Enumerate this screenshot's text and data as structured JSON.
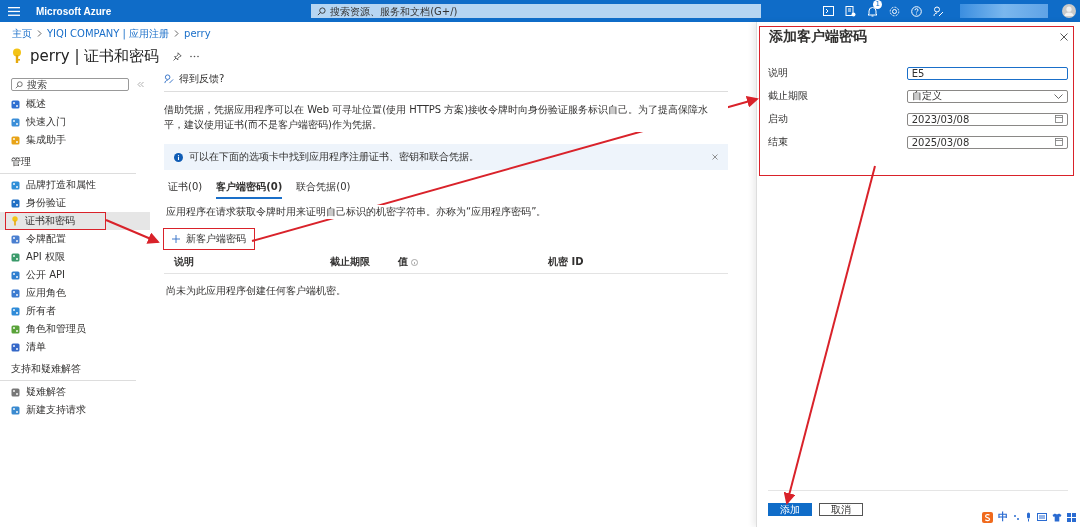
{
  "topbar": {
    "brand": "Microsoft Azure",
    "search_placeholder": "搜索资源、服务和文档(G+/)",
    "notification_count": "1"
  },
  "breadcrumb": [
    "主页",
    "YIQI COMPANY | 应用注册",
    "perry"
  ],
  "page_title": "perry | 证书和密码",
  "sidebar": {
    "search_placeholder": "搜索",
    "sections": [
      {
        "items": [
          {
            "label": "概述",
            "selected": false
          },
          {
            "label": "快速入门",
            "selected": false
          },
          {
            "label": "集成助手",
            "selected": false
          }
        ]
      },
      {
        "heading": "管理",
        "items": [
          {
            "label": "品牌打造和属性",
            "selected": false
          },
          {
            "label": "身份验证",
            "selected": false
          },
          {
            "label": "证书和密码",
            "selected": true
          },
          {
            "label": "令牌配置",
            "selected": false
          },
          {
            "label": "API 权限",
            "selected": false
          },
          {
            "label": "公开 API",
            "selected": false
          },
          {
            "label": "应用角色",
            "selected": false
          },
          {
            "label": "所有者",
            "selected": false
          },
          {
            "label": "角色和管理员",
            "selected": false
          },
          {
            "label": "清单",
            "selected": false
          }
        ]
      },
      {
        "heading": "支持和疑难解答",
        "items": [
          {
            "label": "疑难解答",
            "selected": false
          },
          {
            "label": "新建支持请求",
            "selected": false
          }
        ]
      }
    ]
  },
  "feedback": "得到反馈?",
  "description": "借助凭据，凭据应用程序可以在 Web 可寻址位置(使用 HTTPS 方案)接收令牌时向身份验证服务标识自己。为了提高保障水平，建议使用证书(而不是客户端密码)作为凭据。",
  "info_banner": "可以在下面的选项卡中找到应用程序注册证书、密钥和联合凭据。",
  "tabs": [
    {
      "label": "证书(0)",
      "selected": false
    },
    {
      "label": "客户端密码(0)",
      "selected": true
    },
    {
      "label": "联合凭据(0)",
      "selected": false
    }
  ],
  "tab_description": "应用程序在请求获取令牌时用来证明自己标识的机密字符串。亦称为“应用程序密码”。",
  "new_secret_button": "新客户端密码",
  "table": {
    "columns": [
      "说明",
      "截止期限",
      "值",
      "机密 ID"
    ],
    "empty_message": "尚未为此应用程序创建任何客户端机密。"
  },
  "panel": {
    "title": "添加客户端密码",
    "fields": [
      {
        "label": "说明",
        "kind": "text",
        "value": "E5"
      },
      {
        "label": "截止期限",
        "kind": "select",
        "value": "自定义"
      },
      {
        "label": "启动",
        "kind": "date",
        "value": "2023/03/08"
      },
      {
        "label": "结束",
        "kind": "date",
        "value": "2025/03/08"
      }
    ],
    "buttons": [
      {
        "label": "添加",
        "kind": "primary"
      },
      {
        "label": "取消",
        "kind": "secondary"
      }
    ]
  },
  "ime": {
    "label": "中"
  }
}
